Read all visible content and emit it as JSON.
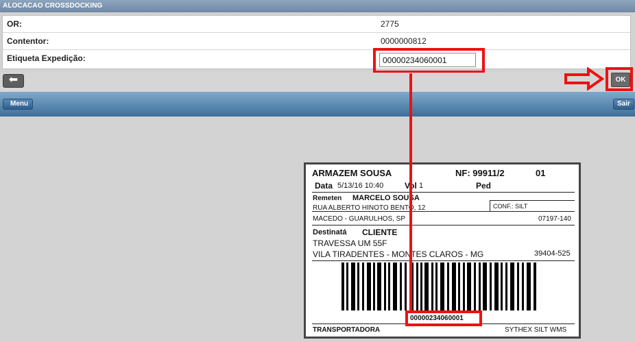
{
  "title": "ALOCACAO CROSSDOCKING",
  "form": {
    "or_label": "OR:",
    "or_value": "2775",
    "contentor_label": "Contentor:",
    "contentor_value": "0000000812",
    "etiqueta_label": "Etiqueta Expedição:",
    "etiqueta_value": "00000234060001"
  },
  "toolbar": {
    "back_label": "⬅",
    "ok_label": "OK"
  },
  "menubar": {
    "menu_label": "Menu",
    "sair_label": "Sair"
  },
  "shipping_label": {
    "company": "ARMAZEM SOUSA",
    "nf": "NF: 99911/2",
    "seq": "01",
    "data_label": "Data",
    "data_value": "5/13/16 10:40",
    "vol_label": "Vol",
    "vol_value": "1",
    "ped_label": "Ped",
    "remetente_label": "Remeten",
    "remetente_name": "MARCELO SOUSA",
    "remetente_address": "RUA ALBERTO HINOTO BENTO, 12",
    "conf": "CONF.: SILT",
    "remetente_city": "MACEDO - GUARULHOS, SP",
    "remetente_cep": "07197-140",
    "destinatario_label": "Destinatá",
    "destinatario_name": "CLIENTE",
    "destinatario_address": "TRAVESSA UM 55F",
    "destinatario_city": "VILA TIRADENTES - MONTES CLAROS - MG",
    "destinatario_cep": "39404-525",
    "barcode_number": "00000234060001",
    "transportadora": "TRANSPORTADORA",
    "footer": "SYTHEX SILT WMS"
  },
  "colors": {
    "highlight": "#ee1111",
    "menubar": "#4f7fa8"
  }
}
